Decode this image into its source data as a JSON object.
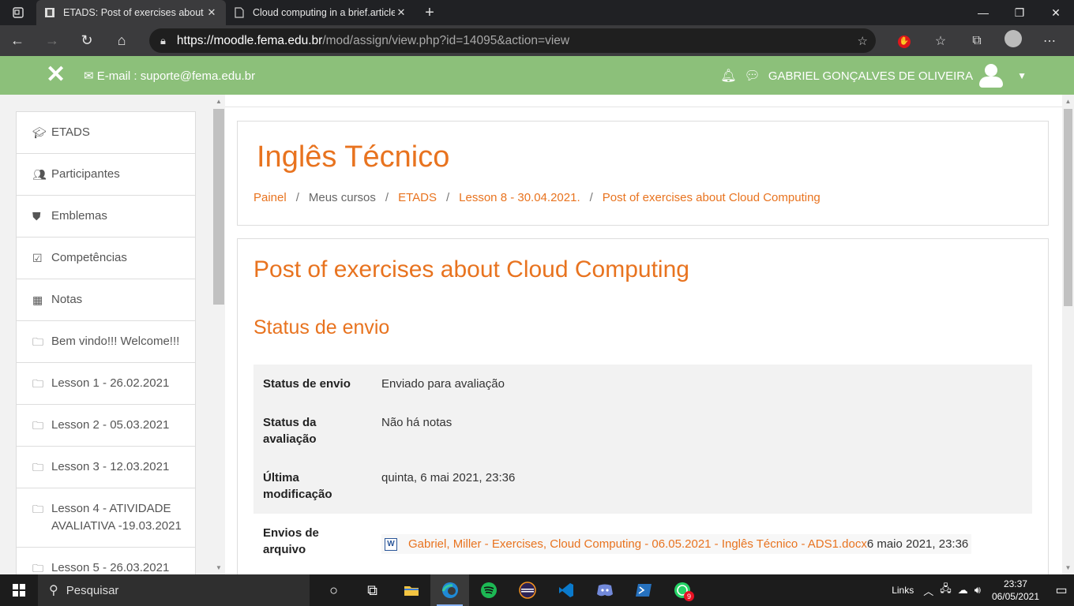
{
  "browser": {
    "tabs": [
      {
        "title": "ETADS: Post of exercises about Cloud Computing",
        "active": true
      },
      {
        "title": "Cloud computing in a brief.article",
        "active": false
      }
    ],
    "url_host": "https://moodle.fema.edu.br",
    "url_path": "/mod/assign/view.php?id=14095&action=view"
  },
  "header": {
    "email": "E-mail : suporte@fema.edu.br",
    "username": "GABRIEL GONÇALVES DE OLIVEIRA"
  },
  "sidebar": {
    "items": [
      {
        "label": "ETADS",
        "icon": "graduation-cap-icon"
      },
      {
        "label": "Participantes",
        "icon": "users-icon"
      },
      {
        "label": "Emblemas",
        "icon": "shield-icon"
      },
      {
        "label": "Competências",
        "icon": "check-square-icon"
      },
      {
        "label": "Notas",
        "icon": "table-icon"
      },
      {
        "label": "Bem vindo!!! Welcome!!!",
        "icon": "folder-icon"
      },
      {
        "label": "Lesson 1 - 26.02.2021",
        "icon": "folder-icon"
      },
      {
        "label": "Lesson 2 - 05.03.2021",
        "icon": "folder-icon"
      },
      {
        "label": "Lesson 3 - 12.03.2021",
        "icon": "folder-icon"
      },
      {
        "label": "Lesson 4 - ATIVIDADE AVALIATIVA -19.03.2021",
        "icon": "folder-icon"
      },
      {
        "label": "Lesson 5 - 26.03.2021",
        "icon": "folder-icon"
      }
    ]
  },
  "course": {
    "title": "Inglês Técnico",
    "breadcrumb": [
      {
        "label": "Painel",
        "link": true
      },
      {
        "label": "Meus cursos",
        "link": false
      },
      {
        "label": "ETADS",
        "link": true
      },
      {
        "label": "Lesson 8 - 30.04.2021.",
        "link": true
      },
      {
        "label": "Post of exercises about Cloud Computing",
        "link": true
      }
    ]
  },
  "assignment": {
    "title": "Post of exercises about Cloud Computing",
    "section_title": "Status de envio",
    "rows": [
      {
        "label": "Status de envio",
        "value": "Enviado para avaliação"
      },
      {
        "label": "Status da avaliação",
        "value": "Não há notas"
      },
      {
        "label": "Última modificação",
        "value": "quinta, 6 mai 2021, 23:36"
      },
      {
        "label": "Envios de arquivo",
        "file_name": "Gabriel, Miller - Exercises, Cloud Computing - 06.05.2021 - Inglês Técnico - ADS1.docx",
        "file_date": "6 maio 2021, 23:36"
      }
    ]
  },
  "taskbar": {
    "search_placeholder": "Pesquisar",
    "links_label": "Links",
    "time": "23:37",
    "date": "06/05/2021",
    "whatsapp_badge": "9"
  },
  "colors": {
    "accent_orange": "#e8731f",
    "header_green": "#8cc07a"
  }
}
